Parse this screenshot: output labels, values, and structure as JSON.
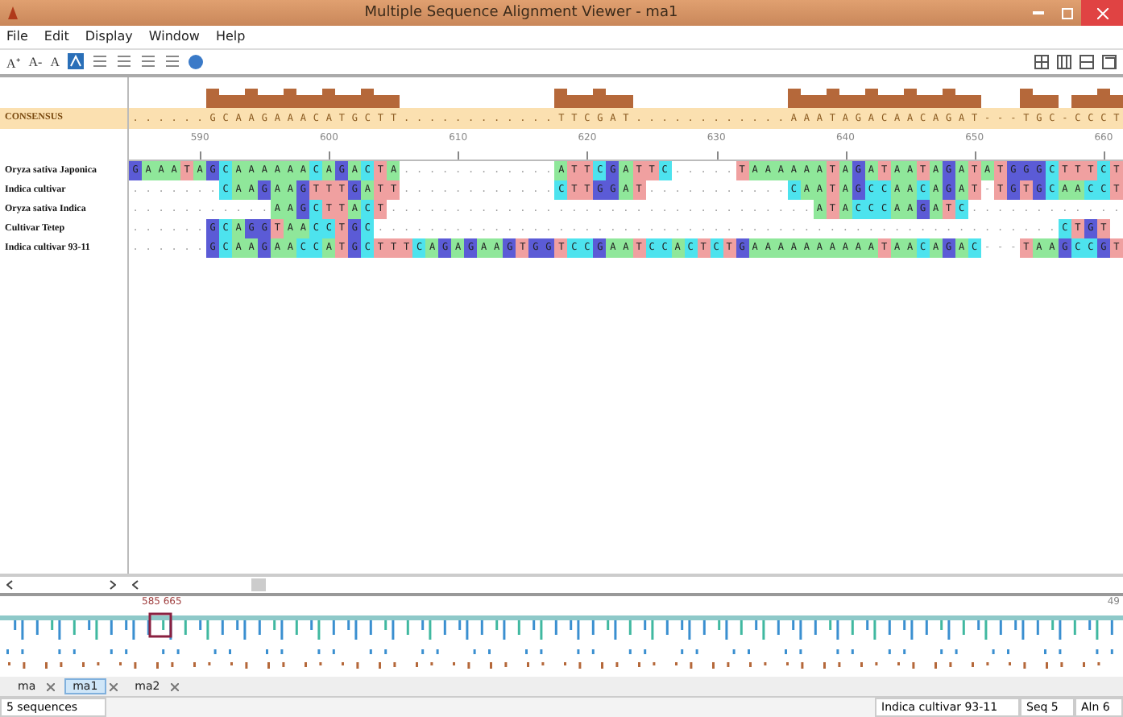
{
  "window": {
    "title": "Multiple Sequence Alignment Viewer - ma1"
  },
  "menu": [
    "File",
    "Edit",
    "Display",
    "Window",
    "Help"
  ],
  "toolbar": [
    "A⁺",
    "A-",
    "A"
  ],
  "consensus": {
    "label": "CONSENSUS",
    "sequence": ". . . . . . G C A A G A A A C A T G C T T . . . . . . . . . . . . T T C G A T . . . . . . . . . . . . A A A T A G A C A A C A G A T - - - T G C - C C C T"
  },
  "ruler": {
    "ticks": [
      "590",
      "600",
      "610",
      "620",
      "630",
      "640",
      "650",
      "660"
    ]
  },
  "sequences": [
    {
      "name": "Oryza sativa Japonica",
      "sequence": "G A A A T A G C A A A A A A C A G A C T A . . . . . . . . . . . . A T T C G A T T C . . . . . T A A A A A A T A G A T A A T A G A T A T G G G C T T T C T"
    },
    {
      "name": "Indica cultivar",
      "sequence": ". . . . . . . C A A G A A G T T T G A T T . . . . . . . . . . . . C T T G G A T . . . . . . . . . . . C A A T A G C C A A C A G A T - T G T G C A A C C T"
    },
    {
      "name": "Oryza sativa Indica",
      "sequence": ". . . . . . . . . . . A A G C T T A C T . . . . . . . . . . . . . . . . . . . . . . . . . . . . . . . . . A T A C C C A A G A T C . . . . . . . . . . . ."
    },
    {
      "name": "Cultivar Tetep",
      "sequence": ". . . . . . G C A G G T A A C C T G C . . . . . . . . . . . . . . . . . . . . . . . . . . . . . . . . . . . . . . . . . . . . . . . . . . . . . C T G T"
    },
    {
      "name": "Indica cultivar 93-11",
      "sequence": ". . . . . . G C A A G A A C C A T G C T T T C A G A G A A G T G G T C C G A A T C C A C T C T G A A A A A A A A A A T A A C A G A C - - - T A A G C C G T"
    }
  ],
  "overview": {
    "range": "585 665",
    "end_label": "49"
  },
  "tabs": [
    {
      "label": "ma",
      "selected": false
    },
    {
      "label": "ma1",
      "selected": true
    },
    {
      "label": "ma2",
      "selected": false
    }
  ],
  "status_bar": {
    "count": "5 sequences",
    "sequence_name": "Indica cultivar 93-11",
    "seq": "Seq  5",
    "aln": "Aln  6"
  }
}
